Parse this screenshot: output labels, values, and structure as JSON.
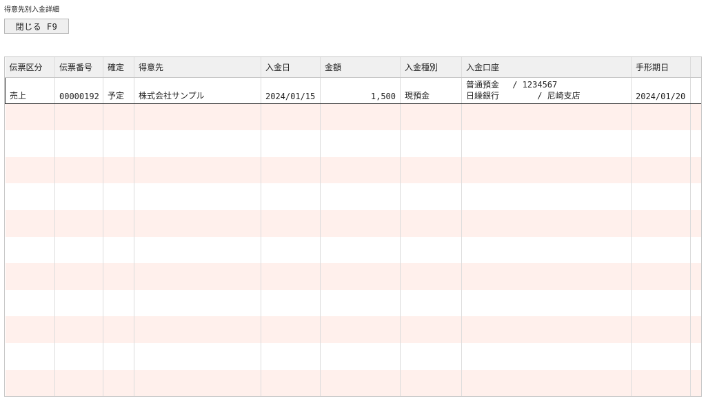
{
  "window": {
    "title": "得意先別入金詳細"
  },
  "toolbar": {
    "close_label": "閉じる F9"
  },
  "table": {
    "headers": [
      "伝票区分",
      "伝票番号",
      "確定",
      "得意先",
      "入金日",
      "金額",
      "入金種別",
      "入金口座",
      "手形期日"
    ],
    "rows": [
      {
        "slip_type": "売上",
        "slip_no": "00000192",
        "confirmed": "予定",
        "customer": "株式会社サンプル",
        "payment_date": "2024/01/15",
        "amount": "1,500",
        "payment_kind": "現預金",
        "account_line1": "普通預金　 / 1234567",
        "account_line2": "日繰銀行　　　　 / 尼崎支店",
        "bill_due": "2024/01/20"
      }
    ]
  },
  "colors": {
    "stripe": "#fff0ec",
    "header_bg": "#f0f0f0"
  }
}
